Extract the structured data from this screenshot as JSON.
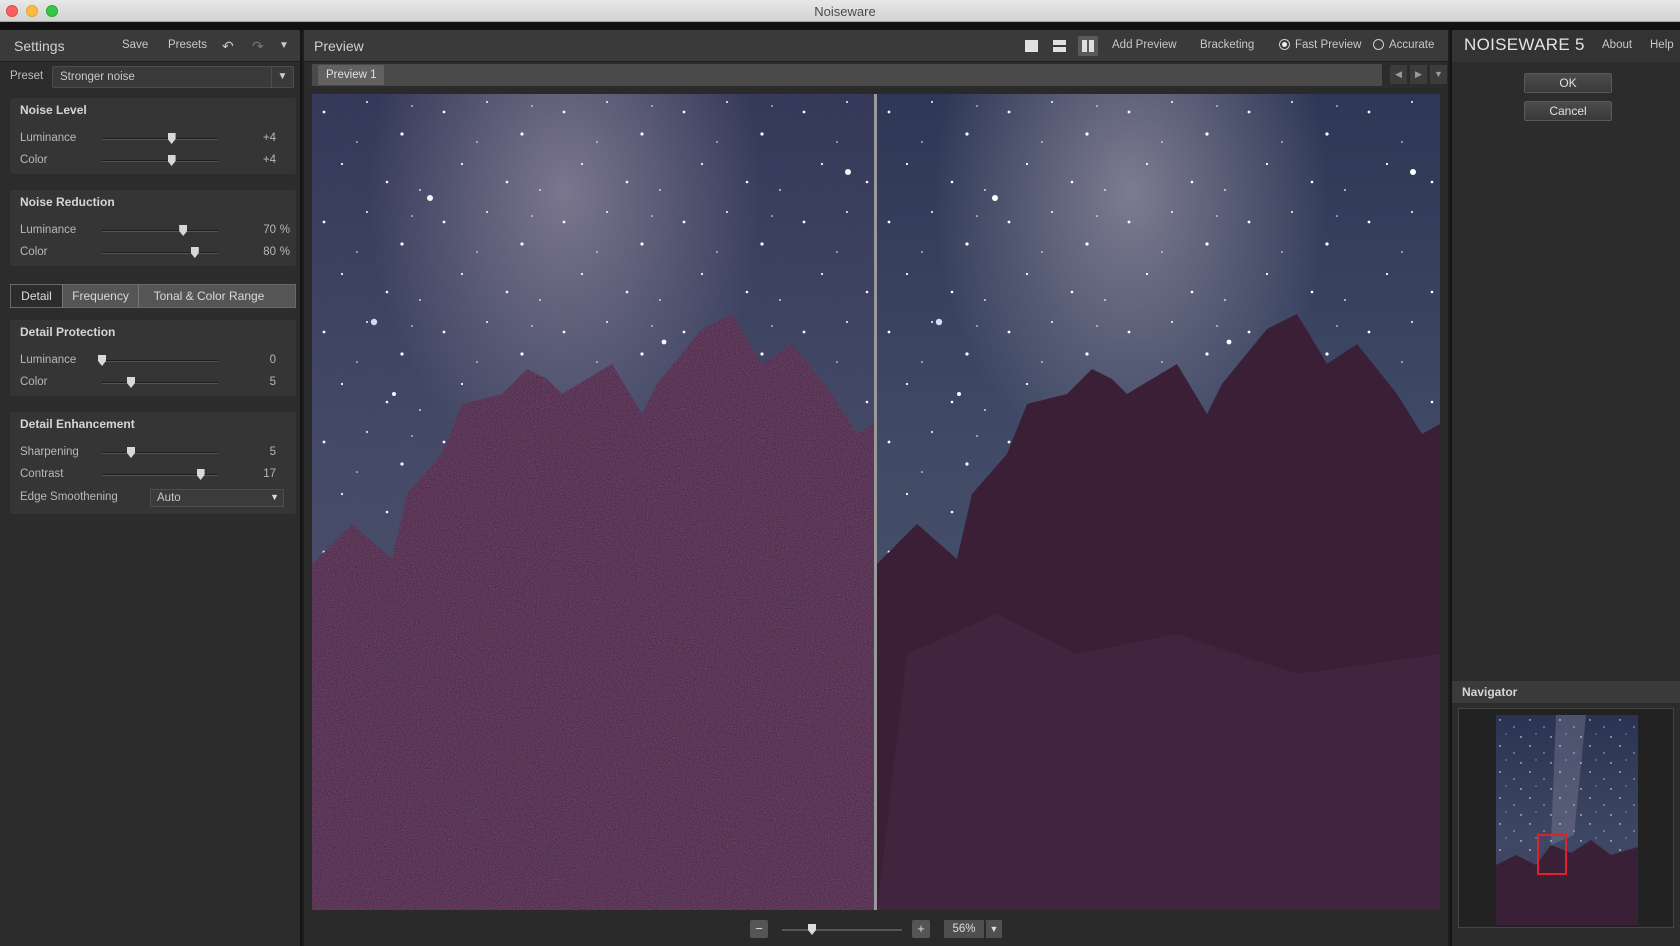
{
  "window": {
    "title": "Noiseware"
  },
  "settings": {
    "title": "Settings",
    "save_label": "Save",
    "presets_label": "Presets",
    "preset_label": "Preset",
    "preset_value": "Stronger noise",
    "noise_level": {
      "title": "Noise Level",
      "rows": [
        {
          "label": "Luminance",
          "value": "+4",
          "level": 0.6
        },
        {
          "label": "Color",
          "value": "+4",
          "level": 0.6
        }
      ]
    },
    "noise_reduction": {
      "title": "Noise Reduction",
      "rows": [
        {
          "label": "Luminance",
          "value": "70",
          "unit": "%",
          "level": 0.7
        },
        {
          "label": "Color",
          "value": "80",
          "unit": "%",
          "level": 0.8
        }
      ]
    },
    "tabs": [
      "Detail",
      "Frequency",
      "Tonal & Color Range"
    ],
    "active_tab": 0,
    "detail_protection": {
      "title": "Detail Protection",
      "rows": [
        {
          "label": "Luminance",
          "value": "0",
          "level": 0.0
        },
        {
          "label": "Color",
          "value": "5",
          "level": 0.25
        }
      ]
    },
    "detail_enhancement": {
      "title": "Detail Enhancement",
      "rows": [
        {
          "label": "Sharpening",
          "value": "5",
          "level": 0.25
        },
        {
          "label": "Contrast",
          "value": "17",
          "level": 0.85
        }
      ],
      "edge_label": "Edge Smoothening",
      "edge_value": "Auto"
    }
  },
  "preview": {
    "title": "Preview",
    "add_preview": "Add Preview",
    "bracketing": "Bracketing",
    "fast_preview": "Fast Preview",
    "accurate": "Accurate",
    "mode_selected": "fast",
    "tab_label": "Preview 1",
    "zoom_value": "56%",
    "zoom_level": 0.25
  },
  "right": {
    "brand": "NOISEWARE 5",
    "about": "About",
    "help": "Help",
    "ok": "OK",
    "cancel": "Cancel",
    "navigator": "Navigator"
  },
  "colors": {
    "panel_bg": "#2c2c2c",
    "accent_red": "#e0232a",
    "sky_dark": "#1f2a44",
    "tree_purple": "#3a1f35"
  }
}
